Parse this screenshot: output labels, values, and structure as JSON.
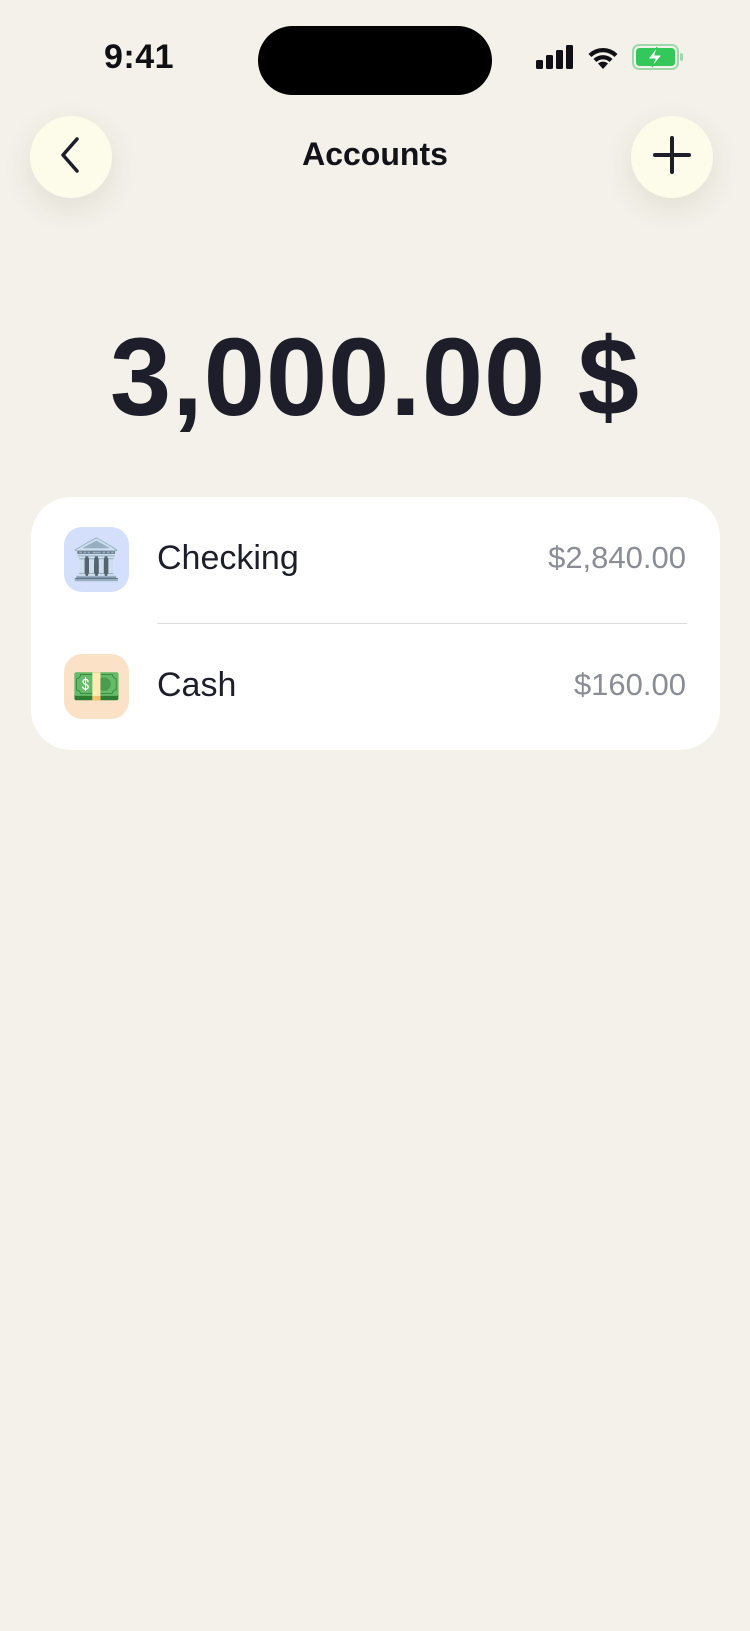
{
  "status_bar": {
    "time": "9:41",
    "icons": [
      "cellular-signal-icon",
      "wifi-icon",
      "battery-charging-icon"
    ]
  },
  "header": {
    "title": "Accounts",
    "back_icon": "chevron-left-icon",
    "add_icon": "plus-icon"
  },
  "total": {
    "amount": "3,000.00 $"
  },
  "accounts": [
    {
      "name": "Checking",
      "amount": "$2,840.00",
      "icon": "bank-icon",
      "icon_glyph": "🏛️",
      "icon_bg": "#d4e0fb"
    },
    {
      "name": "Cash",
      "amount": "$160.00",
      "icon": "dollar-banknote-icon",
      "icon_glyph": "💵",
      "icon_bg": "#fbe2c6"
    }
  ],
  "colors": {
    "background": "#f3f1e9",
    "card": "#ffffff",
    "button_bg": "#fdfbea",
    "text_primary": "#1d1e29",
    "text_secondary": "#8b8c96",
    "battery_green": "#34c759"
  }
}
